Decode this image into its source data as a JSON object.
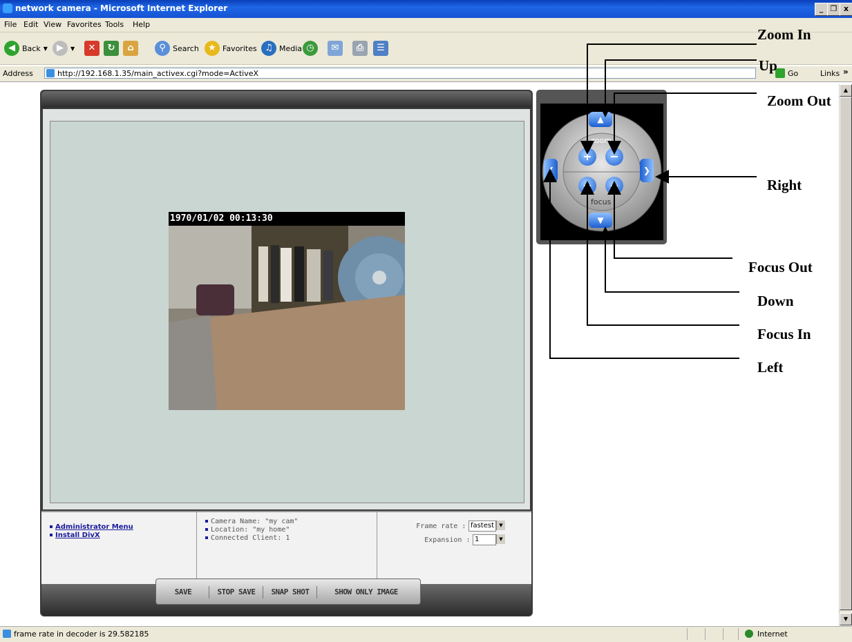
{
  "window": {
    "title": "network camera - Microsoft Internet Explorer",
    "buttons": [
      "_",
      "❐",
      "x"
    ]
  },
  "menu": [
    "File",
    "Edit",
    "View",
    "Favorites",
    "Tools",
    "Help"
  ],
  "toolbar": {
    "back": "Back",
    "search": "Search",
    "favorites": "Favorites",
    "media": "Media"
  },
  "address": {
    "label": "Address",
    "url": "http://192.168.1.35/main_activex.cgi?mode=ActiveX",
    "go": "Go",
    "links": "Links"
  },
  "video": {
    "timestamp": "1970/01/02 00:13:30"
  },
  "info": {
    "links": [
      "Administrator Menu",
      "Install DivX"
    ],
    "camera_name": "Camera Name: \"my cam\"",
    "location": "Location: \"my home\"",
    "clients": "Connected Client: 1",
    "frame_rate_label": "Frame rate :",
    "frame_rate_value": "fastest",
    "expansion_label": "Expansion :",
    "expansion_value": "1"
  },
  "controls": [
    "SAVE",
    "STOP SAVE",
    "SNAP SHOT",
    "SHOW ONLY IMAGE"
  ],
  "ptz": {
    "zoom": "zoom",
    "focus": "focus"
  },
  "annotations": {
    "zoom_in": "Zoom In",
    "up": "Up",
    "zoom_out": "Zoom Out",
    "right": "Right",
    "focus_out": "Focus Out",
    "down": "Down",
    "focus_in": "Focus In",
    "left": "Left"
  },
  "status": {
    "text": "frame rate in decoder is 29.582185",
    "zone": "Internet"
  }
}
